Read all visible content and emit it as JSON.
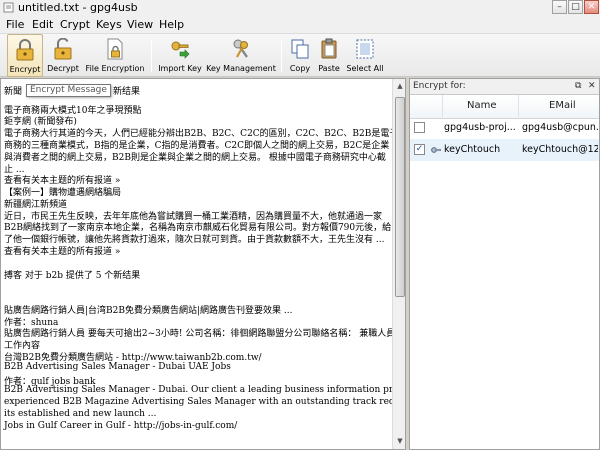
{
  "window": {
    "title": "untitled.txt - gpg4usb"
  },
  "window_controls": {
    "minimize": "–",
    "maximize": "□",
    "close": "✕"
  },
  "menu": [
    "File",
    "Edit",
    "Crypt",
    "Keys",
    "View",
    "Help"
  ],
  "toolbar": {
    "buttons": [
      {
        "label": "Encrypt",
        "icon": "lock-closed-icon"
      },
      {
        "label": "Decrypt",
        "icon": "lock-open-icon"
      },
      {
        "label": "File Encryption",
        "icon": "file-lock-icon"
      },
      {
        "label": "Import Key",
        "icon": "key-import-icon"
      },
      {
        "label": "Key Management",
        "icon": "keys-icon"
      },
      {
        "label": "Copy",
        "icon": "copy-icon"
      },
      {
        "label": "Paste",
        "icon": "paste-icon"
      },
      {
        "label": "Select All",
        "icon": "select-all-icon"
      }
    ]
  },
  "tooltip": "Encrypt Message",
  "editor": {
    "lines": [
      "新聞",
      "電子商務兩大模式10年之爭現預點",
      "鉅亨網 (新聞發布)",
      "電子商務大行其道的今天，人們已經能分辯出B2B、B2C、C2C的區別，C2C、B2C、B2B是電子",
      "商務的三種商業模式，B指的是企業，C指的是消費者。C2C即個人之間的網上交易，B2C是企業",
      "與消費者之間的網上交易，B2B則是企業與企業之間的網上交易。 根據中國電子商務研究中心截",
      "止 ...",
      "查看有关本主题的所有报道 »",
      "【案例一】購物遭遇網絡騙局",
      "新疆網江新頻道",
      "近日，市民王先生反映，去年年底他為嘗試購買一桶工業酒精，因為購買量不大，他就通過一家",
      "B2B網絡找到了一家南京本地企業，名稱為南京市麒威石化貿易有限公司。對方報價790元後，給",
      "了他一個銀行帳號，讓他先將貨款打過來，隨次日就可到貨。由于貨款數額不大，王先生沒有 ...",
      "查看有关本主题的所有报道 »",
      "",
      "搏客 对于 b2b 提供了 5 个新结果",
      "",
      "",
      "貼廣告網路行銷人員|台湾B2B免費分類廣告網站|網路廣告刊登要效果 ...",
      "作者：shuna",
      "貼廣告網路行銷人員 要每天可搶出2~3小時! 公司名稱：徘徊網路聯盟分公司聯絡名稱： 兼職人員",
      "工作內容",
      "台灣B2B免費分類廣告網站 - http://www.taiwanb2b.com.tw/",
      "B2B Advertising Sales Manager - Dubai UAE Jobs",
      "作者：gulf jobs bank",
      "B2B Advertising Sales Manager - Dubai. Our client a leading business information provider seeks an",
      "experienced B2B Magazine Advertising Sales Manager with an outstanding track record of success to sell on",
      "its established and new launch ...",
      "Jobs in Gulf Career in Gulf - http://jobs-in-gulf.com/"
    ],
    "header_tail": "新结果"
  },
  "encrypt_panel": {
    "title": "Encrypt for:",
    "float_button": "⧉",
    "close_button": "✕",
    "columns": {
      "name": "Name",
      "email": "EMail"
    },
    "keys": [
      {
        "checked": false,
        "name": "gpg4usb-proj...",
        "email": "gpg4usb@cpun..."
      },
      {
        "checked": true,
        "name": "keyChtouch",
        "email": "keyChtouch@12..."
      }
    ],
    "check_mark": "✓"
  },
  "colors": {
    "selected_row": "#e8f2fb",
    "tooltip_border": "#767676"
  }
}
